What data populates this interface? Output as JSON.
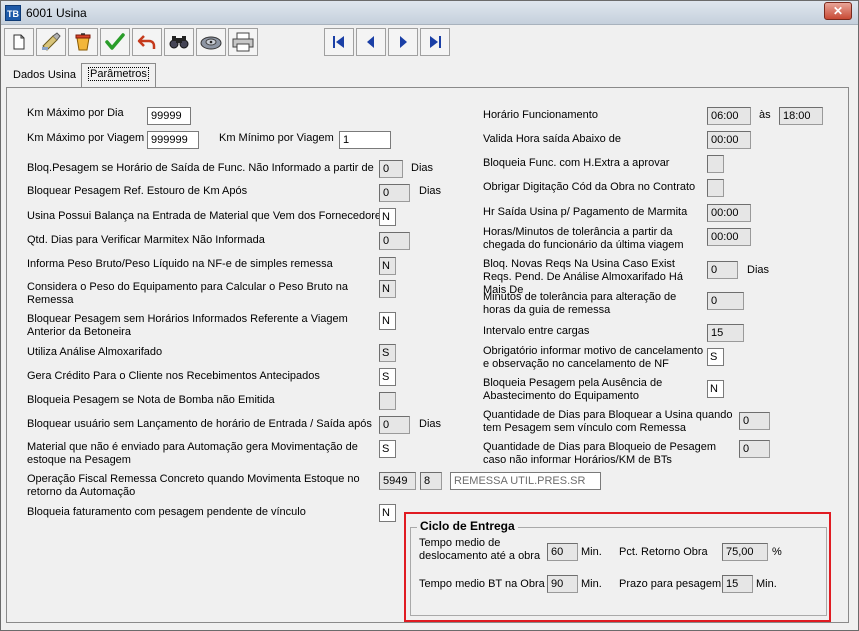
{
  "window": {
    "app_icon": "TB",
    "title": "6001 Usina",
    "close_label": "✕"
  },
  "toolbar": {
    "buttons": [
      "new-icon",
      "clean-icon",
      "delete-icon",
      "confirm-icon",
      "undo-icon",
      "search-icon",
      "vault-icon",
      "print-icon"
    ],
    "nav": [
      "first-icon",
      "previous-icon",
      "next-icon",
      "last-icon"
    ]
  },
  "tabs": [
    "Dados Usina",
    "Parâmetros"
  ],
  "left": {
    "km_max_dia_label": "Km Máximo por Dia",
    "km_max_dia_value": "99999",
    "km_max_viagem_label": "Km Máximo por Viagem",
    "km_max_viagem_value": "999999",
    "km_min_viagem_label": "Km Mínimo por Viagem",
    "km_min_viagem_value": "1",
    "bloq_saida_label": "Bloq.Pesagem se Horário de Saída de Func. Não Informado a partir de",
    "bloq_saida_value": "0",
    "bloq_saida_unit": "Dias",
    "bloq_km_label": "Bloquear Pesagem Ref. Estouro de Km Após",
    "bloq_km_value": "0",
    "bloq_km_unit": "Dias",
    "balanca_label": "Usina Possui Balança na Entrada de Material que Vem dos Fornecedores",
    "balanca_value": "N",
    "marmitex_label": "Qtd. Dias para Verificar Marmitex Não Informada",
    "marmitex_value": "0",
    "peso_nfe_label": "Informa Peso Bruto/Peso Líquido na NF-e de simples remessa",
    "peso_nfe_value": "N",
    "peso_equip_label": "Considera o Peso do Equipamento para Calcular o Peso Bruto na Remessa",
    "peso_equip_value": "N",
    "bloq_horarios_label": "Bloquear Pesagem sem Horários Informados Referente a Viagem Anterior da Betoneira",
    "bloq_horarios_value": "N",
    "almox_label": "Utiliza Análise Almoxarifado",
    "almox_value": "S",
    "credito_label": "Gera Crédito Para o Cliente nos Recebimentos Antecipados",
    "credito_value": "S",
    "bomba_label": "Bloqueia Pesagem se Nota de Bomba não Emitida",
    "bomba_value": "",
    "bloq_usuario_label": "Bloquear usuário sem Lançamento de horário de Entrada / Saída após",
    "bloq_usuario_value": "0",
    "bloq_usuario_unit": "Dias",
    "automacao_label": "Material que não é enviado para Automação gera Movimentação de estoque na Pesagem",
    "automacao_value": "S",
    "op_fiscal_label": "Operação Fiscal Remessa Concreto quando Movimenta Estoque no retorno da Automação",
    "op_fiscal_code": "5949",
    "op_fiscal_seq": "8",
    "op_fiscal_desc": "REMESSA UTIL.PRES.SR",
    "bloq_fat_label": "Bloqueia faturamento com pesagem pendente de vínculo",
    "bloq_fat_value": "N"
  },
  "right": {
    "horario_func_label": "Horário Funcionamento",
    "horario_func_start": "06:00",
    "horario_func_sep": "às",
    "horario_func_end": "18:00",
    "valida_hora_label": "Valida Hora saída Abaixo de",
    "valida_hora_value": "00:00",
    "bloq_extra_label": "Bloqueia Func. com H.Extra a aprovar",
    "bloq_extra_value": "",
    "obra_contrato_label": "Obrigar Digitação Cód da Obra no Contrato",
    "obra_contrato_value": "",
    "hr_saida_label": "Hr Saída Usina p/ Pagamento de Marmita",
    "hr_saida_value": "00:00",
    "tolerancia_chegada_label": "Horas/Minutos de tolerância a partir da chegada do funcionário da última viagem",
    "tolerancia_chegada_value": "00:00",
    "bloq_reqs_label": "Bloq. Novas Reqs Na Usina Caso Exist Reqs. Pend. De Análise Almoxarifado Há Mais De",
    "bloq_reqs_value": "0",
    "bloq_reqs_unit": "Dias",
    "tolerancia_guia_label": "Minutos de tolerância para alteração de horas da guia de remessa",
    "tolerancia_guia_value": "0",
    "intervalo_label": "Intervalo entre cargas",
    "intervalo_value": "15",
    "motivo_label": "Obrigatório informar motivo de cancelamento e observação no cancelamento de NF",
    "motivo_value": "S",
    "abastecimento_label": "Bloqueia Pesagem pela Ausência de Abastecimento do Equipamento",
    "abastecimento_value": "N",
    "dias_vinculo_label": "Quantidade de Dias para Bloquear a Usina quando tem Pesagem sem vínculo com Remessa",
    "dias_vinculo_value": "0",
    "dias_horarios_label": "Quantidade de Dias para Bloqueio de Pesagem caso não informar Horários/KM de BTs",
    "dias_horarios_value": "0"
  },
  "ciclo": {
    "title": "Ciclo de Entrega",
    "deslocamento_label": "Tempo medio de deslocamento até a obra",
    "deslocamento_value": "60",
    "deslocamento_unit": "Min.",
    "retorno_label": "Pct. Retorno Obra",
    "retorno_value": "75,00",
    "retorno_unit": "%",
    "bt_obra_label": "Tempo medio BT na Obra",
    "bt_obra_value": "90",
    "bt_obra_unit": "Min.",
    "prazo_label": "Prazo para pesagem",
    "prazo_value": "15",
    "prazo_unit": "Min."
  },
  "colors": {
    "highlight": "#e01b22",
    "accent": "#1a3fa6"
  }
}
